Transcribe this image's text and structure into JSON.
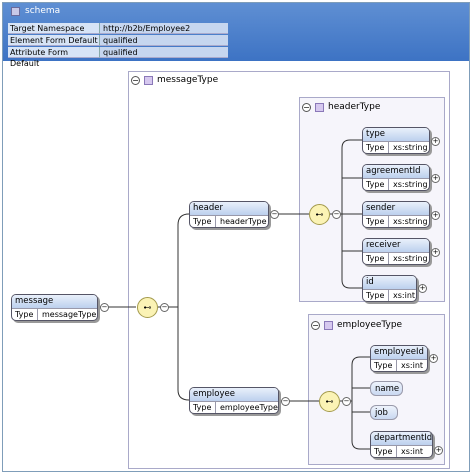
{
  "schema": {
    "title": "schema",
    "properties": [
      {
        "key": "Target Namespace",
        "value": "http://b2b/Employee2"
      },
      {
        "key": "Element Form Default",
        "value": "qualified"
      },
      {
        "key": "Attribute Form Default",
        "value": "qualified"
      }
    ]
  },
  "groups": {
    "messageType": "messageType",
    "headerType": "headerType",
    "employeeType": "employeeType"
  },
  "type_label": "Type",
  "elements": {
    "message": {
      "name": "message",
      "type": "messageType"
    },
    "header": {
      "name": "header",
      "type": "headerType"
    },
    "employee": {
      "name": "employee",
      "type": "employeeType"
    },
    "type": {
      "name": "type",
      "type": "xs:string"
    },
    "agreementId": {
      "name": "agreementId",
      "type": "xs:string"
    },
    "sender": {
      "name": "sender",
      "type": "xs:string"
    },
    "receiver": {
      "name": "receiver",
      "type": "xs:string"
    },
    "id": {
      "name": "id",
      "type": "xs:int"
    },
    "employeeId": {
      "name": "employeeId",
      "type": "xs:int"
    },
    "name": {
      "name": "name"
    },
    "job": {
      "name": "job"
    },
    "departmentId": {
      "name": "departmentId",
      "type": "xs:int"
    }
  },
  "colors": {
    "header_bar": "#3d73c4",
    "element_fill": "#bcd0ee",
    "compositor_fill": "#fbf3b5",
    "group_fill": "#f6f5fb"
  }
}
